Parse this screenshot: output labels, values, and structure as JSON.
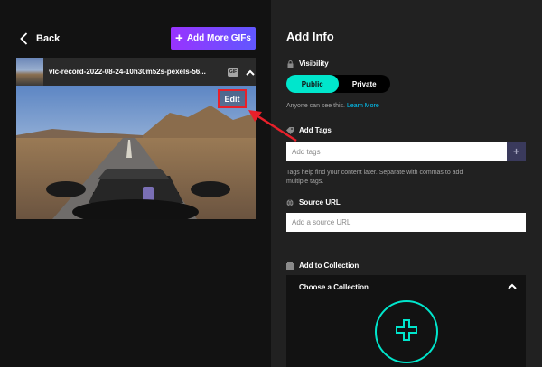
{
  "left": {
    "back_label": "Back",
    "add_more_label": "Add More GIFs",
    "file_name": "vlc-record-2022-08-24-10h30m52s-pexels-56...",
    "gif_badge": "GIF",
    "edit_label": "Edit"
  },
  "right": {
    "title": "Add Info",
    "visibility": {
      "label": "Visibility",
      "options": [
        "Public",
        "Private"
      ],
      "selected": "Public",
      "helper": "Anyone can see this.",
      "helper_link": "Learn More"
    },
    "tags": {
      "label": "Add Tags",
      "placeholder": "Add tags",
      "add_symbol": "+",
      "helper_line1": "Tags help find your content later. Separate with commas to add",
      "helper_line2": "multiple tags."
    },
    "source": {
      "label": "Source URL",
      "placeholder": "Add a source URL"
    },
    "collection": {
      "label": "Add to Collection",
      "header": "Choose a Collection"
    }
  },
  "colors": {
    "accent_teal": "#00e6cc",
    "accent_purple": "#9933ff",
    "annotation_red": "#e8202a",
    "link_blue": "#00ccff"
  }
}
